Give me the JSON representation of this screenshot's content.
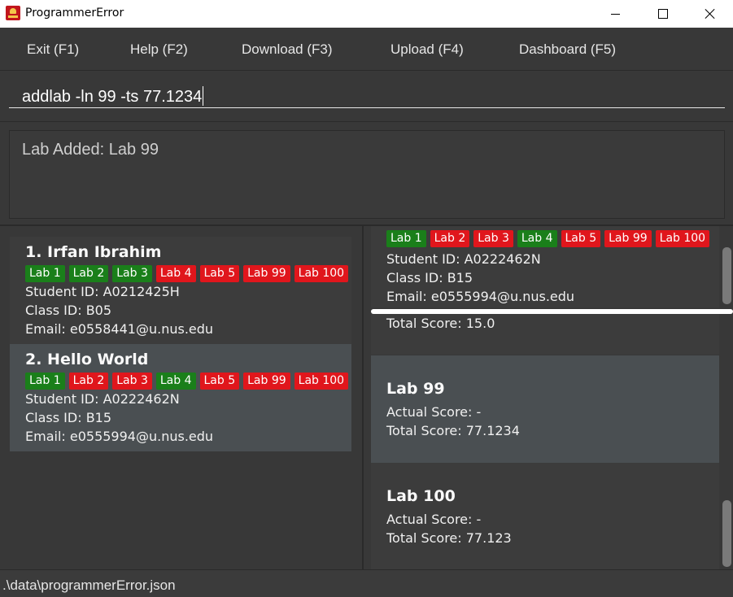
{
  "window": {
    "title": "ProgrammerError"
  },
  "menu": {
    "exit": "Exit (F1)",
    "help": "Help (F2)",
    "download": "Download (F3)",
    "upload": "Upload (F4)",
    "dashboard": "Dashboard (F5)"
  },
  "command": {
    "value": "addlab -ln 99 -ts 77.1234"
  },
  "result": {
    "text": "Lab Added: Lab 99"
  },
  "colors": {
    "tag_done": "#1a7f1a",
    "tag_pending": "#e0161c",
    "selected_card": "#4a4f52"
  },
  "students": [
    {
      "name": "1.  Irfan Ibrahim",
      "labs": [
        {
          "label": "Lab 1",
          "status": "done"
        },
        {
          "label": "Lab 2",
          "status": "done"
        },
        {
          "label": "Lab 3",
          "status": "done"
        },
        {
          "label": "Lab 4",
          "status": "pending"
        },
        {
          "label": "Lab 5",
          "status": "pending"
        },
        {
          "label": "Lab 99",
          "status": "pending"
        },
        {
          "label": "Lab 100",
          "status": "pending"
        }
      ],
      "student_id": "Student ID: A0212425H",
      "class_id": "Class ID: B05",
      "email": "Email: e0558441@u.nus.edu"
    },
    {
      "name": "2.  Hello World",
      "labs": [
        {
          "label": "Lab 1",
          "status": "done"
        },
        {
          "label": "Lab 2",
          "status": "pending"
        },
        {
          "label": "Lab 3",
          "status": "pending"
        },
        {
          "label": "Lab 4",
          "status": "done"
        },
        {
          "label": "Lab 5",
          "status": "pending"
        },
        {
          "label": "Lab 99",
          "status": "pending"
        },
        {
          "label": "Lab 100",
          "status": "pending"
        }
      ],
      "student_id": "Student ID: A0222462N",
      "class_id": "Class ID: B15",
      "email": "Email: e0555994@u.nus.edu"
    }
  ],
  "detail": {
    "labs": [
      {
        "label": "Lab 1",
        "status": "done"
      },
      {
        "label": "Lab 2",
        "status": "pending"
      },
      {
        "label": "Lab 3",
        "status": "pending"
      },
      {
        "label": "Lab 4",
        "status": "done"
      },
      {
        "label": "Lab 5",
        "status": "pending"
      },
      {
        "label": "Lab 99",
        "status": "pending"
      },
      {
        "label": "Lab 100",
        "status": "pending"
      }
    ],
    "student_id": "Student ID: A0222462N",
    "class_id": "Class ID: B15",
    "email": "Email: e0555994@u.nus.edu",
    "prev_total_score": "Total Score: 15.0",
    "lab_results": [
      {
        "title": "Lab 99",
        "actual": "Actual Score: -",
        "total": "Total Score: 77.1234"
      },
      {
        "title": "Lab 100",
        "actual": "Actual Score: -",
        "total": "Total Score: 77.123"
      }
    ]
  },
  "status": {
    "path": ".\\data\\programmerError.json"
  }
}
